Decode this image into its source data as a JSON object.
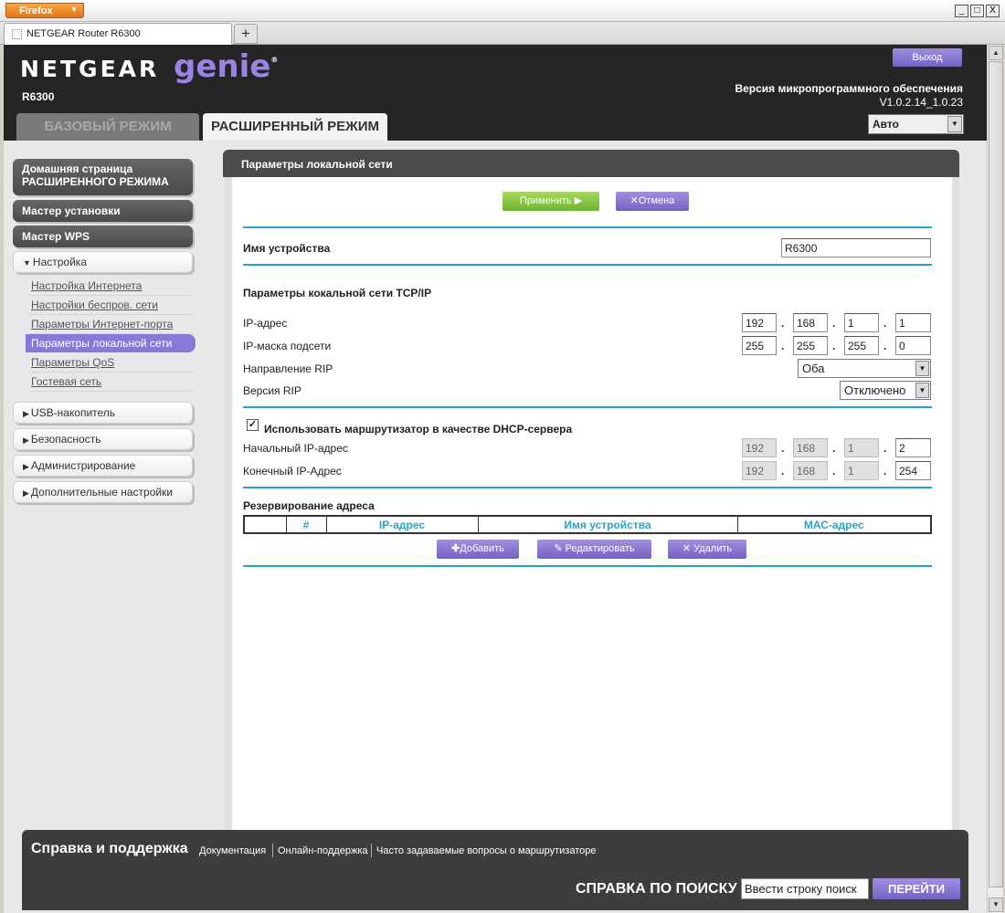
{
  "browser": {
    "app_button": "Firefox",
    "tab_title": "NETGEAR Router R6300",
    "new_tab": "+",
    "win_min": "_",
    "win_max": "□",
    "win_close": "X"
  },
  "header": {
    "brand": "NETGEAR",
    "product": "genie",
    "trademark": "®",
    "model": "R6300",
    "logout": "Выход",
    "firmware_label": "Версия микропрограммного обеспечения",
    "firmware_version": "V1.0.2.14_1.0.23",
    "language": "Авто",
    "tab_basic": "БАЗОВЫЙ РЕЖИМ",
    "tab_advanced": "РАСШИРЕННЫЙ РЕЖИМ"
  },
  "nav": {
    "home_line1": "Домашняя страница",
    "home_line2": "РАСШИРЕННОГО РЕЖИМА",
    "setup_wizard": "Мастер установки",
    "wps_wizard": "Мастер WPS",
    "setup": "Настройка",
    "sub": [
      "Настройка Интернета",
      "Настройки беспров. сети",
      "Параметры Интернет-порта",
      "Параметры локальной сети",
      "Параметры QoS",
      "Гостевая сеть"
    ],
    "usb": "USB-накопитель",
    "security": "Безопасность",
    "admin": "Администрирование",
    "advanced": "Дополнительные настройки"
  },
  "content": {
    "title": "Параметры локальной сети",
    "apply": "Применить",
    "cancel": "Отмена",
    "device_name_label": "Имя устройства",
    "device_name": "R6300",
    "tcpip_section": "Параметры кокальной сети TCP/IP",
    "ip_label": "IP-адрес",
    "ip": [
      "192",
      "168",
      "1",
      "1"
    ],
    "mask_label": "IP-маска подсети",
    "mask": [
      "255",
      "255",
      "255",
      "0"
    ],
    "rip_dir_label": "Направление RIP",
    "rip_dir": "Оба",
    "rip_ver_label": "Версия RIP",
    "rip_ver": "Отключено",
    "dhcp_label": "Использовать маршрутизатор в качестве DHCP-сервера",
    "dhcp_checked": true,
    "start_ip_label": "Начальный IP-адрес",
    "start_ip": [
      "192",
      "168",
      "1",
      "2"
    ],
    "end_ip_label": "Конечный IP-Адрес",
    "end_ip": [
      "192",
      "168",
      "1",
      "254"
    ],
    "reservation_title": "Резервирование адреса",
    "table_headers": [
      "",
      "#",
      "IP-адрес",
      "Имя устройства",
      "МАС-адрес"
    ],
    "add": "Добавить",
    "edit": "Редактировать",
    "delete": "Удалить"
  },
  "footer": {
    "title": "Справка и поддержка",
    "links": [
      "Документация",
      "Онлайн-поддержка",
      "Часто задаваемые вопросы о маршрутизаторе"
    ],
    "search_label": "СПРАВКА ПО ПОИСКУ",
    "search_value": "Ввести строку поиск",
    "search_button": "ПЕРЕЙТИ"
  },
  "colors": {
    "accent_purple": "#7462c2",
    "accent_green": "#70b430",
    "divider_blue": "#29a3c6",
    "header_dark": "#252525"
  }
}
